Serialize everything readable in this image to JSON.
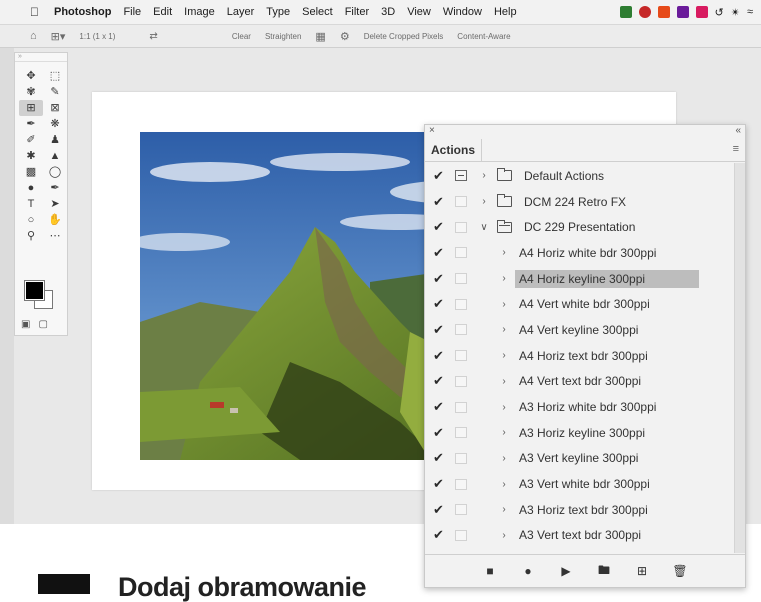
{
  "menubar": {
    "app_name": "Photoshop",
    "items": [
      "File",
      "Edit",
      "Image",
      "Layer",
      "Type",
      "Select",
      "Filter",
      "3D",
      "View",
      "Window",
      "Help"
    ]
  },
  "options_bar": {
    "ratio": "1:1 (1 x 1)",
    "clear": "Clear",
    "straighten": "Straighten",
    "delete_cropped": "Delete Cropped Pixels",
    "content_aware": "Content-Aware"
  },
  "actions_panel": {
    "close_glyph": "×",
    "collapse_glyph": "«",
    "tab_label": "Actions",
    "menu_glyph": "≡",
    "rows": [
      {
        "label": "Default Actions",
        "level": 0,
        "kind": "folder",
        "expanded": false,
        "dialog": true,
        "selected": false
      },
      {
        "label": "DCM 224 Retro FX",
        "level": 0,
        "kind": "folder",
        "expanded": false,
        "dialog": false,
        "selected": false
      },
      {
        "label": "DC 229 Presentation",
        "level": 0,
        "kind": "folder",
        "expanded": true,
        "dialog": false,
        "selected": false
      },
      {
        "label": "A4 Horiz white bdr 300ppi",
        "level": 1,
        "kind": "action",
        "expanded": false,
        "dialog": false,
        "selected": false
      },
      {
        "label": "A4 Horiz keyline 300ppi",
        "level": 1,
        "kind": "action",
        "expanded": false,
        "dialog": false,
        "selected": true
      },
      {
        "label": "A4 Vert white bdr 300ppi",
        "level": 1,
        "kind": "action",
        "expanded": false,
        "dialog": false,
        "selected": false
      },
      {
        "label": "A4 Vert keyline 300ppi",
        "level": 1,
        "kind": "action",
        "expanded": false,
        "dialog": false,
        "selected": false
      },
      {
        "label": "A4 Horiz text bdr 300ppi",
        "level": 1,
        "kind": "action",
        "expanded": false,
        "dialog": false,
        "selected": false
      },
      {
        "label": "A4 Vert text bdr 300ppi",
        "level": 1,
        "kind": "action",
        "expanded": false,
        "dialog": false,
        "selected": false
      },
      {
        "label": "A3 Horiz white bdr 300ppi",
        "level": 1,
        "kind": "action",
        "expanded": false,
        "dialog": false,
        "selected": false
      },
      {
        "label": "A3 Horiz keyline 300ppi",
        "level": 1,
        "kind": "action",
        "expanded": false,
        "dialog": false,
        "selected": false
      },
      {
        "label": "A3 Vert keyline 300ppi",
        "level": 1,
        "kind": "action",
        "expanded": false,
        "dialog": false,
        "selected": false
      },
      {
        "label": "A3 Vert white bdr 300ppi",
        "level": 1,
        "kind": "action",
        "expanded": false,
        "dialog": false,
        "selected": false
      },
      {
        "label": "A3 Horiz text bdr 300ppi",
        "level": 1,
        "kind": "action",
        "expanded": false,
        "dialog": false,
        "selected": false
      },
      {
        "label": "A3 Vert text bdr 300ppi",
        "level": 1,
        "kind": "action",
        "expanded": false,
        "dialog": false,
        "selected": false
      }
    ],
    "footer_buttons": [
      "stop-icon",
      "record-icon",
      "play-icon",
      "new-set-icon",
      "new-action-icon",
      "trash-icon"
    ]
  },
  "caption": {
    "text": "Dodaj obramowanie"
  },
  "colors": {
    "selected_row": "#bdbdbd",
    "panel_bg": "#f2f2f2",
    "workspace_bg": "#e8e8e8"
  }
}
